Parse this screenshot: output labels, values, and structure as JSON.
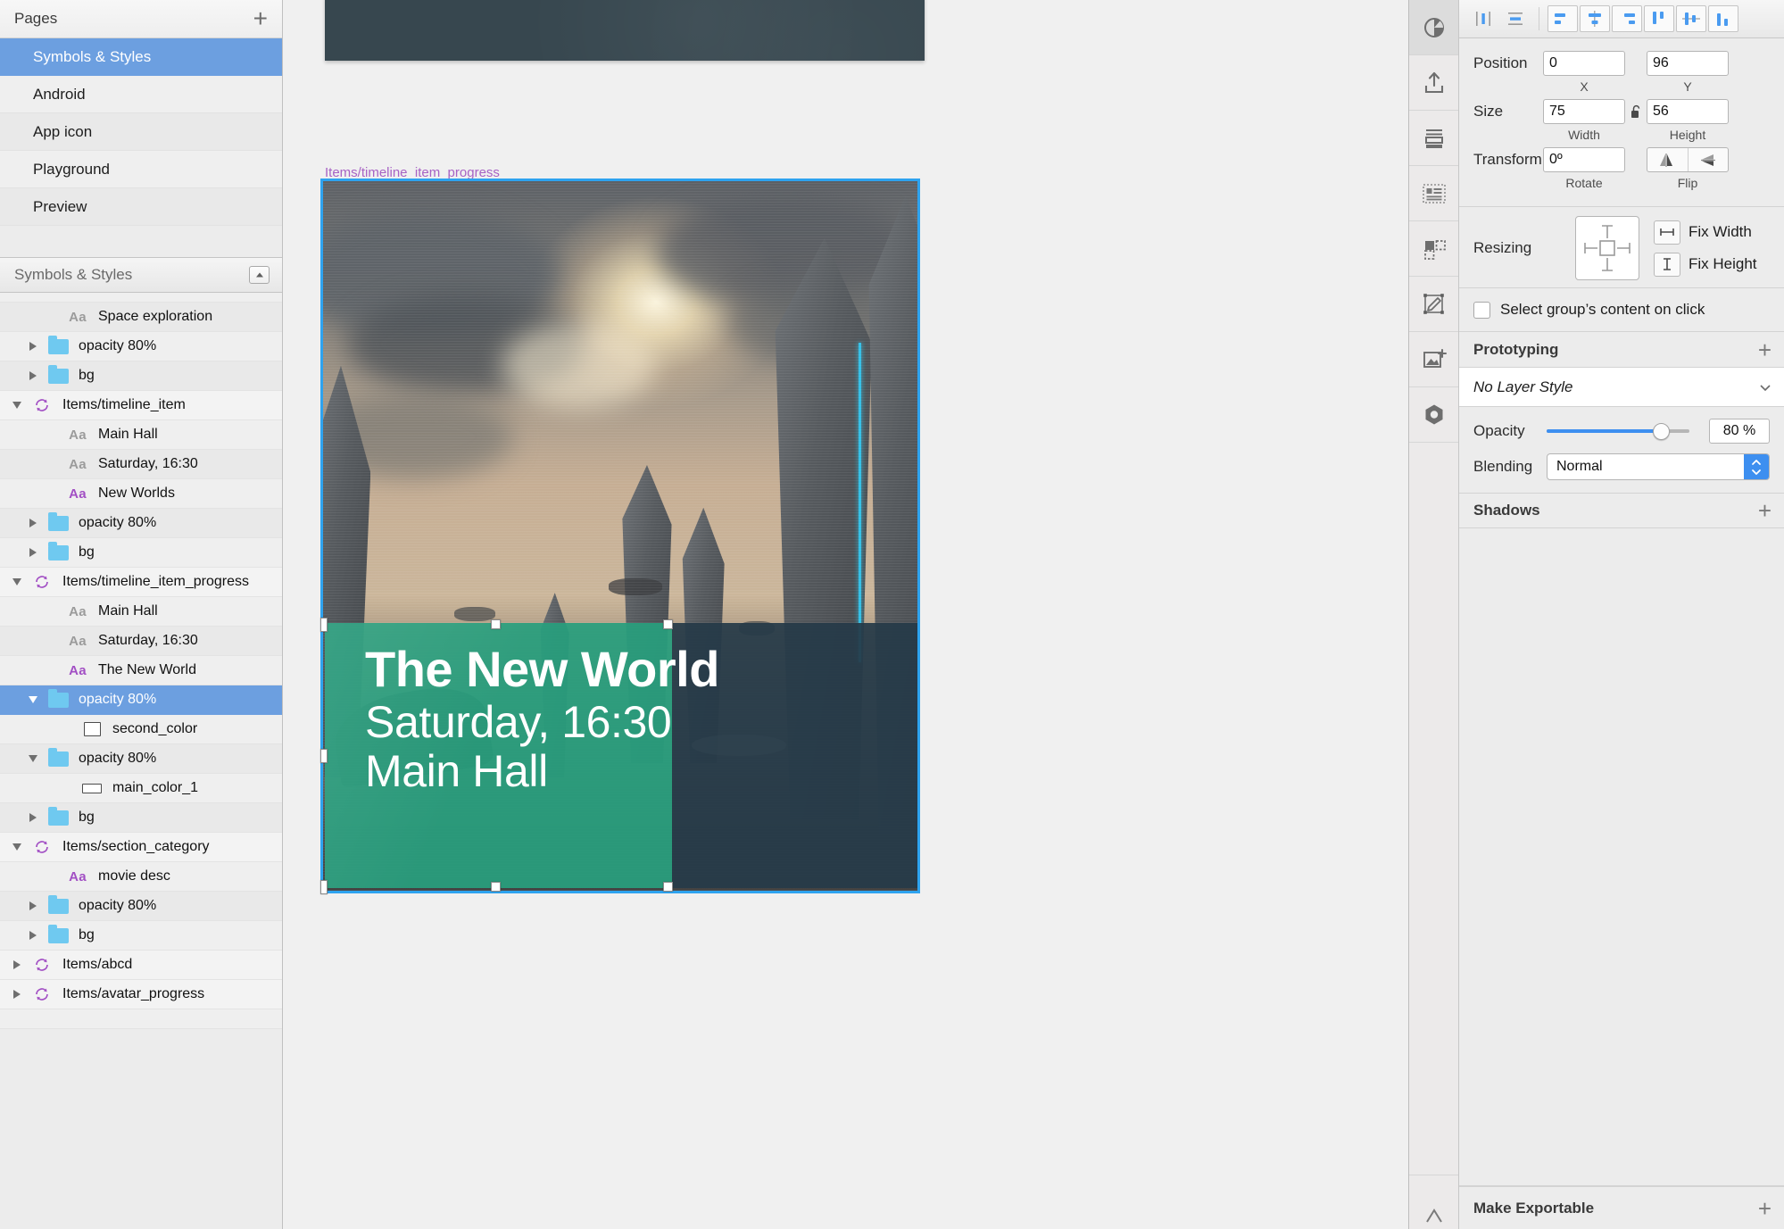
{
  "pages_panel": {
    "title": "Pages",
    "add_icon": "plus-icon",
    "items": [
      {
        "label": "Symbols & Styles",
        "selected": true
      },
      {
        "label": "Android",
        "selected": false
      },
      {
        "label": "App icon",
        "selected": false
      },
      {
        "label": "Playground",
        "selected": false
      },
      {
        "label": "Preview",
        "selected": false
      }
    ]
  },
  "layers_panel": {
    "title": "Symbols & Styles",
    "collapse_icon": "collapse-up-icon",
    "rows": [
      {
        "label": "Space exploration",
        "kind": "text",
        "indent": 2,
        "disclosure": "none",
        "accent": "gray"
      },
      {
        "label": "opacity 80%",
        "kind": "folder",
        "indent": 1,
        "disclosure": "closed"
      },
      {
        "label": "bg",
        "kind": "folder",
        "indent": 1,
        "disclosure": "closed"
      },
      {
        "label": "Items/timeline_item",
        "kind": "symbol",
        "indent": 0,
        "disclosure": "open"
      },
      {
        "label": "Main Hall",
        "kind": "text",
        "indent": 2,
        "disclosure": "none",
        "accent": "gray"
      },
      {
        "label": "Saturday, 16:30",
        "kind": "text",
        "indent": 2,
        "disclosure": "none",
        "accent": "gray"
      },
      {
        "label": "New Worlds",
        "kind": "text",
        "indent": 2,
        "disclosure": "none",
        "accent": "purple"
      },
      {
        "label": "opacity 80%",
        "kind": "folder",
        "indent": 1,
        "disclosure": "closed"
      },
      {
        "label": "bg",
        "kind": "folder",
        "indent": 1,
        "disclosure": "closed"
      },
      {
        "label": "Items/timeline_item_progress",
        "kind": "symbol",
        "indent": 0,
        "disclosure": "open"
      },
      {
        "label": "Main Hall",
        "kind": "text",
        "indent": 2,
        "disclosure": "none",
        "accent": "gray"
      },
      {
        "label": "Saturday, 16:30",
        "kind": "text",
        "indent": 2,
        "disclosure": "none",
        "accent": "gray"
      },
      {
        "label": "The New World",
        "kind": "text",
        "indent": 2,
        "disclosure": "none",
        "accent": "purple"
      },
      {
        "label": "opacity 80%",
        "kind": "folder",
        "indent": 1,
        "disclosure": "open",
        "selected": true
      },
      {
        "label": "second_color",
        "kind": "square",
        "indent": 2,
        "disclosure": "none"
      },
      {
        "label": "opacity 80%",
        "kind": "folder",
        "indent": 1,
        "disclosure": "open"
      },
      {
        "label": "main_color_1",
        "kind": "rect",
        "indent": 2,
        "disclosure": "none"
      },
      {
        "label": "bg",
        "kind": "folder",
        "indent": 1,
        "disclosure": "closed"
      },
      {
        "label": "Items/section_category",
        "kind": "symbol",
        "indent": 0,
        "disclosure": "open"
      },
      {
        "label": "movie desc",
        "kind": "text",
        "indent": 2,
        "disclosure": "none",
        "accent": "purple"
      },
      {
        "label": "opacity 80%",
        "kind": "folder",
        "indent": 1,
        "disclosure": "closed"
      },
      {
        "label": "bg",
        "kind": "folder",
        "indent": 1,
        "disclosure": "closed"
      },
      {
        "label": "Items/abcd",
        "kind": "symbol",
        "indent": 0,
        "disclosure": "closed"
      },
      {
        "label": "Items/avatar_progress",
        "kind": "symbol",
        "indent": 0,
        "disclosure": "closed"
      }
    ]
  },
  "canvas": {
    "selected_layer_label": "Items/timeline_item_progress",
    "card": {
      "title": "The New World",
      "subtitle": "Saturday, 16:30",
      "location": "Main Hall",
      "overlay_color": "#289e7d",
      "overlay_dark_color": "#263a48"
    },
    "selection_color": "#2ea3ef"
  },
  "inspector": {
    "align_buttons": [
      {
        "name": "distribute-horizontally-icon"
      },
      {
        "name": "distribute-vertically-icon"
      },
      {
        "name": "align-left-icon"
      },
      {
        "name": "align-horizontal-center-icon"
      },
      {
        "name": "align-right-icon"
      },
      {
        "name": "align-top-icon"
      },
      {
        "name": "align-vertical-center-icon"
      },
      {
        "name": "align-bottom-icon"
      }
    ],
    "position": {
      "label": "Position",
      "x": "0",
      "y": "96",
      "x_sublabel": "X",
      "y_sublabel": "Y"
    },
    "size": {
      "label": "Size",
      "width": "75",
      "height": "56",
      "width_sublabel": "Width",
      "height_sublabel": "Height",
      "lock_icon": "lock-open-icon"
    },
    "transform": {
      "label": "Transform",
      "rotate": "0º",
      "rotate_sublabel": "Rotate",
      "flip_sublabel": "Flip",
      "flip_horizontal_icon": "flip-horizontal-icon",
      "flip_vertical_icon": "flip-vertical-icon"
    },
    "resizing": {
      "label": "Resizing",
      "anchor_icon": "resize-anchor-icon",
      "fix_width_label": "Fix Width",
      "fix_height_label": "Fix Height",
      "fix_width_icon": "fix-width-icon",
      "fix_height_icon": "fix-height-icon"
    },
    "select_group": {
      "label": "Select group’s content on click",
      "checked": false
    },
    "prototyping": {
      "label": "Prototyping",
      "add_icon": "plus-icon"
    },
    "layer_style": {
      "value": "No Layer Style",
      "chevron_icon": "chevron-down-icon"
    },
    "opacity": {
      "label": "Opacity",
      "value": "80 %",
      "percent": 80,
      "accent": "#3d8ff0"
    },
    "blending": {
      "label": "Blending",
      "value": "Normal",
      "stepper_icon": "stepper-updown-icon"
    },
    "shadows": {
      "label": "Shadows",
      "add_icon": "plus-icon"
    },
    "make_exportable": {
      "label": "Make Exportable",
      "add_icon": "plus-icon"
    },
    "rail_icons": [
      {
        "name": "contrast-icon",
        "active": true
      },
      {
        "name": "export-upload-icon",
        "active": false
      },
      {
        "name": "layout-stack-icon",
        "active": false
      },
      {
        "name": "text-layout-icon",
        "active": false
      },
      {
        "name": "mask-shapes-icon",
        "active": false
      },
      {
        "name": "edit-vector-icon",
        "active": false
      },
      {
        "name": "add-image-icon",
        "active": false
      },
      {
        "name": "symbol-nut-icon",
        "active": false
      }
    ]
  }
}
